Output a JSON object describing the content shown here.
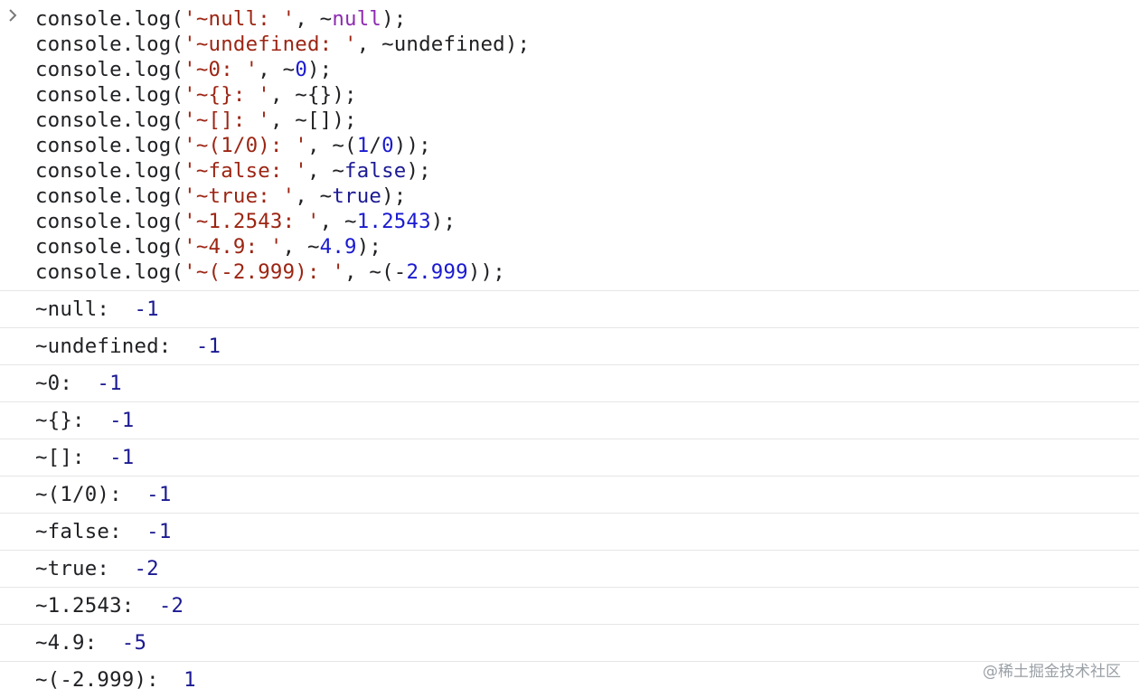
{
  "input": {
    "lines": [
      [
        {
          "t": "console.log(",
          "c": "c-plain"
        },
        {
          "t": "'~null: '",
          "c": "c-str"
        },
        {
          "t": ", ~",
          "c": "c-plain"
        },
        {
          "t": "null",
          "c": "c-kw"
        },
        {
          "t": ");",
          "c": "c-plain"
        }
      ],
      [
        {
          "t": "console.log(",
          "c": "c-plain"
        },
        {
          "t": "'~undefined: '",
          "c": "c-str"
        },
        {
          "t": ", ~undefined);",
          "c": "c-plain"
        }
      ],
      [
        {
          "t": "console.log(",
          "c": "c-plain"
        },
        {
          "t": "'~0: '",
          "c": "c-str"
        },
        {
          "t": ", ~",
          "c": "c-plain"
        },
        {
          "t": "0",
          "c": "c-num"
        },
        {
          "t": ");",
          "c": "c-plain"
        }
      ],
      [
        {
          "t": "console.log(",
          "c": "c-plain"
        },
        {
          "t": "'~{}: '",
          "c": "c-str"
        },
        {
          "t": ", ~{});",
          "c": "c-plain"
        }
      ],
      [
        {
          "t": "console.log(",
          "c": "c-plain"
        },
        {
          "t": "'~[]: '",
          "c": "c-str"
        },
        {
          "t": ", ~[]);",
          "c": "c-plain"
        }
      ],
      [
        {
          "t": "console.log(",
          "c": "c-plain"
        },
        {
          "t": "'~(1/0): '",
          "c": "c-str"
        },
        {
          "t": ", ~(",
          "c": "c-plain"
        },
        {
          "t": "1",
          "c": "c-num"
        },
        {
          "t": "/",
          "c": "c-plain"
        },
        {
          "t": "0",
          "c": "c-num"
        },
        {
          "t": "));",
          "c": "c-plain"
        }
      ],
      [
        {
          "t": "console.log(",
          "c": "c-plain"
        },
        {
          "t": "'~false: '",
          "c": "c-str"
        },
        {
          "t": ", ~",
          "c": "c-plain"
        },
        {
          "t": "false",
          "c": "c-bool"
        },
        {
          "t": ");",
          "c": "c-plain"
        }
      ],
      [
        {
          "t": "console.log(",
          "c": "c-plain"
        },
        {
          "t": "'~true: '",
          "c": "c-str"
        },
        {
          "t": ", ~",
          "c": "c-plain"
        },
        {
          "t": "true",
          "c": "c-bool"
        },
        {
          "t": ");",
          "c": "c-plain"
        }
      ],
      [
        {
          "t": "console.log(",
          "c": "c-plain"
        },
        {
          "t": "'~1.2543: '",
          "c": "c-str"
        },
        {
          "t": ", ~",
          "c": "c-plain"
        },
        {
          "t": "1.2543",
          "c": "c-num"
        },
        {
          "t": ");",
          "c": "c-plain"
        }
      ],
      [
        {
          "t": "console.log(",
          "c": "c-plain"
        },
        {
          "t": "'~4.9: '",
          "c": "c-str"
        },
        {
          "t": ", ~",
          "c": "c-plain"
        },
        {
          "t": "4.9",
          "c": "c-num"
        },
        {
          "t": ");",
          "c": "c-plain"
        }
      ],
      [
        {
          "t": "console.log(",
          "c": "c-plain"
        },
        {
          "t": "'~(-2.999): '",
          "c": "c-str"
        },
        {
          "t": ", ~(-",
          "c": "c-plain"
        },
        {
          "t": "2.999",
          "c": "c-num"
        },
        {
          "t": "));",
          "c": "c-plain"
        }
      ]
    ]
  },
  "output": [
    {
      "label": "~null: ",
      "value": "-1"
    },
    {
      "label": "~undefined: ",
      "value": "-1"
    },
    {
      "label": "~0: ",
      "value": "-1"
    },
    {
      "label": "~{}: ",
      "value": "-1"
    },
    {
      "label": "~[]: ",
      "value": "-1"
    },
    {
      "label": "~(1/0): ",
      "value": "-1"
    },
    {
      "label": "~false: ",
      "value": "-1"
    },
    {
      "label": "~true: ",
      "value": "-2"
    },
    {
      "label": "~1.2543: ",
      "value": "-2"
    },
    {
      "label": "~4.9: ",
      "value": "-5"
    },
    {
      "label": "~(-2.999): ",
      "value": "1"
    }
  ],
  "watermark": "@稀土掘金技术社区",
  "icons": {
    "prompt": "chevron-right-icon"
  },
  "colors": {
    "string": "#9c2513",
    "keyword": "#8e2bb0",
    "number": "#1a1ad0",
    "value": "#1b1a92",
    "divider": "#e6e6e6"
  }
}
